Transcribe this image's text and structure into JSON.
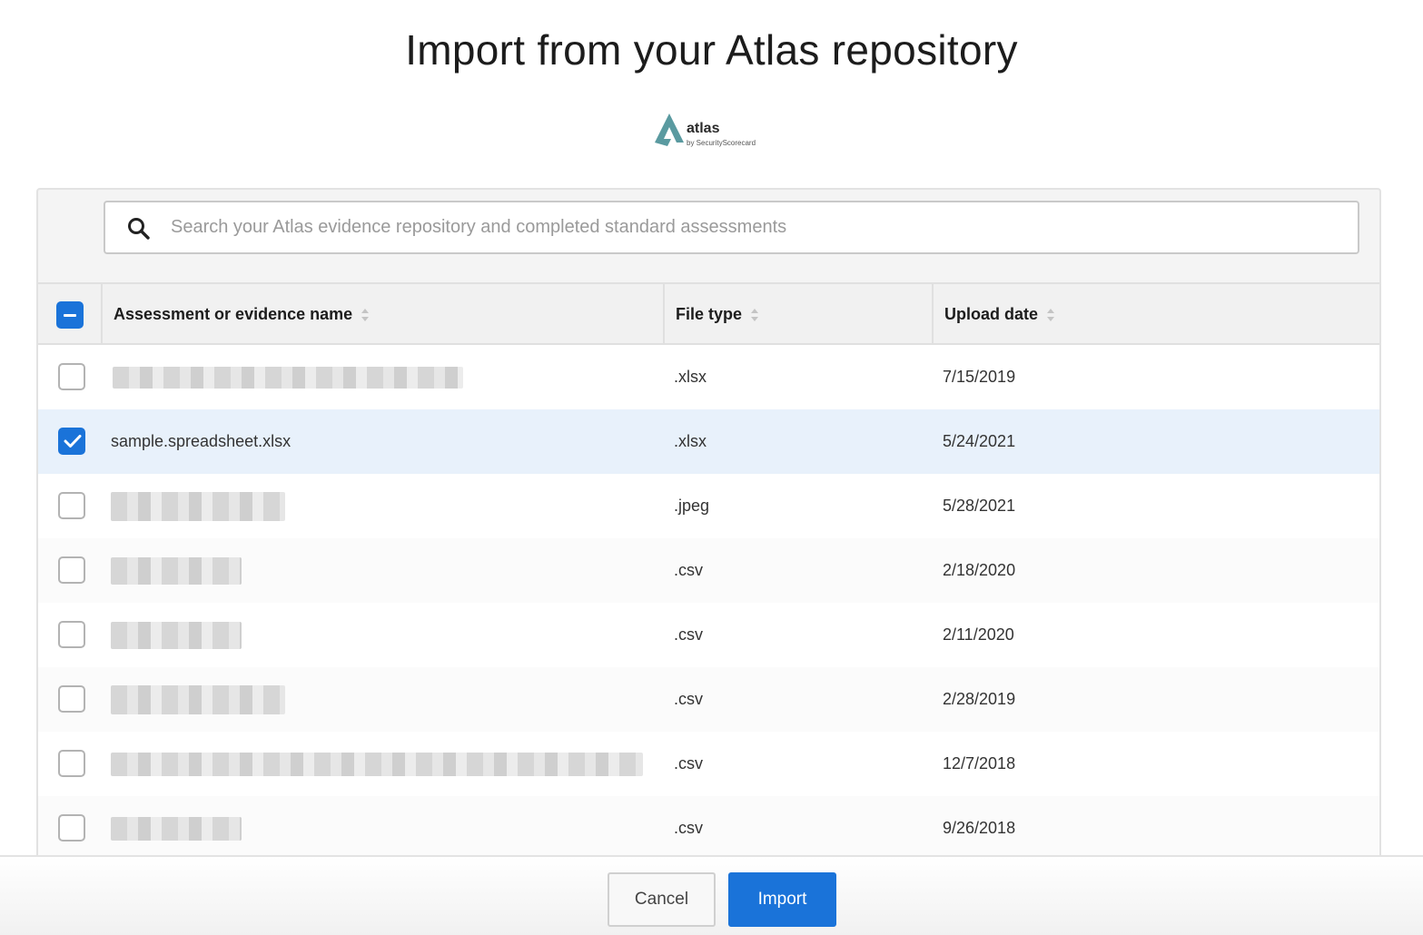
{
  "dialog": {
    "title": "Import from your Atlas repository"
  },
  "logo": {
    "name": "atlas",
    "tagline": "by SecurityScorecard",
    "color": "#5a9aa0"
  },
  "search": {
    "icon": "search-icon",
    "placeholder": "Search your Atlas evidence repository and completed standard assessments",
    "value": ""
  },
  "table": {
    "select_all_state": "partial",
    "columns": [
      {
        "label": "Assessment or evidence name"
      },
      {
        "label": "File type"
      },
      {
        "label": "Upload date"
      }
    ],
    "rows": [
      {
        "checked": false,
        "name": "",
        "redacted": true,
        "file_type": ".xlsx",
        "upload_date": "7/15/2019"
      },
      {
        "checked": true,
        "name": "sample.spreadsheet.xlsx",
        "redacted": false,
        "file_type": ".xlsx",
        "upload_date": "5/24/2021"
      },
      {
        "checked": false,
        "name": "",
        "redacted": true,
        "file_type": ".jpeg",
        "upload_date": "5/28/2021"
      },
      {
        "checked": false,
        "name": "",
        "redacted": true,
        "file_type": ".csv",
        "upload_date": "2/18/2020"
      },
      {
        "checked": false,
        "name": "",
        "redacted": true,
        "file_type": ".csv",
        "upload_date": "2/11/2020"
      },
      {
        "checked": false,
        "name": "",
        "redacted": true,
        "file_type": ".csv",
        "upload_date": "2/28/2019"
      },
      {
        "checked": false,
        "name": "",
        "redacted": true,
        "file_type": ".csv",
        "upload_date": "12/7/2018"
      },
      {
        "checked": false,
        "name": "",
        "redacted": true,
        "file_type": ".csv",
        "upload_date": "9/26/2018"
      }
    ]
  },
  "footer": {
    "cancel_label": "Cancel",
    "import_label": "Import"
  },
  "colors": {
    "accent": "#1a73d9",
    "selected_row": "#e8f1fb"
  }
}
